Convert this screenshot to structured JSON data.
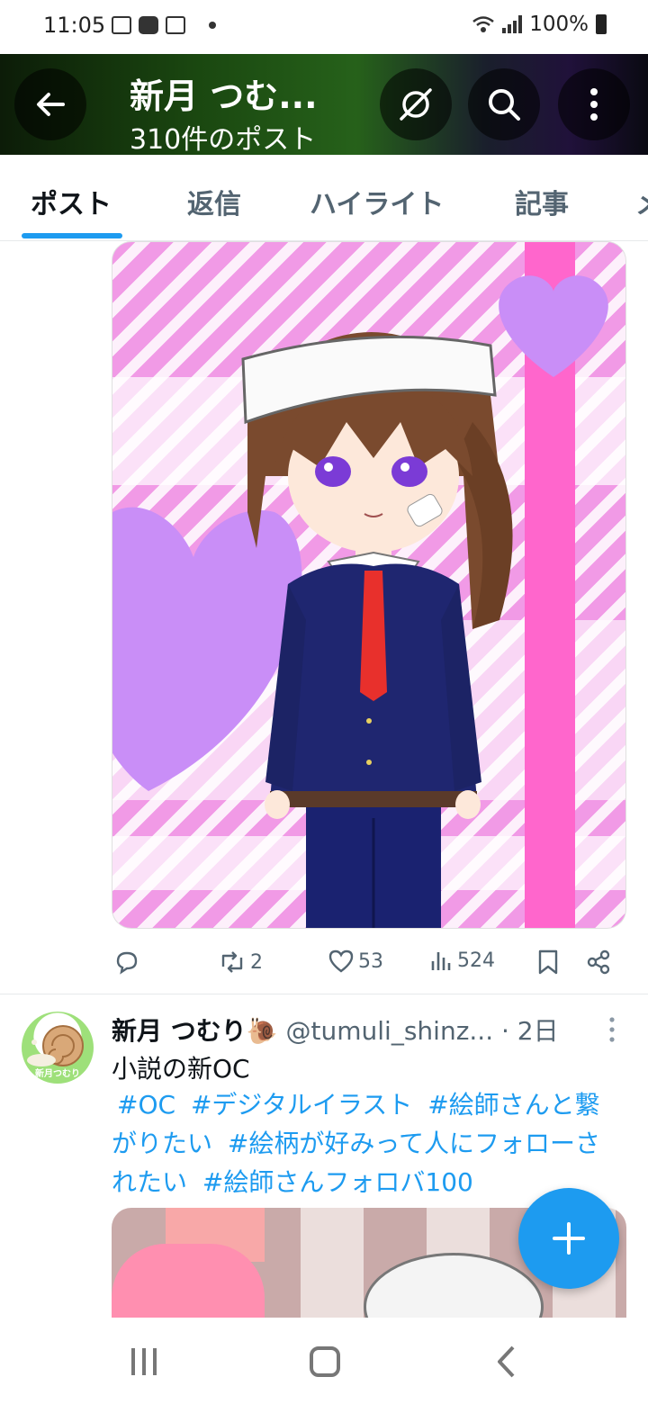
{
  "status_bar": {
    "time": "11:05",
    "battery": "100%"
  },
  "header": {
    "title": "新月 つむ...",
    "subtitle": "310件のポスト"
  },
  "tabs": [
    {
      "label": "ポスト",
      "active": true
    },
    {
      "label": "返信"
    },
    {
      "label": "ハイライト"
    },
    {
      "label": "記事"
    },
    {
      "label": "メ"
    }
  ],
  "post1": {
    "replies": "",
    "reposts": "2",
    "likes": "53",
    "views": "524"
  },
  "post2": {
    "name": "新月 つむり🐌",
    "handle": "@tumuli_shinz...",
    "time": "· 2日",
    "text": "小説の新OC",
    "tags": [
      "#OC",
      "#デジタルイラスト",
      "#絵師さんと繋がりたい",
      "#絵柄が好みって人にフォローされたい",
      "#絵師さんフォロバ100"
    ],
    "avatar_text": "新月つむり"
  },
  "colors": {
    "accent": "#1d9bf0",
    "muted": "#536471",
    "text": "#0f1419"
  },
  "icons": {
    "back": "arrow-left-icon",
    "offline": "no-signal-icon",
    "search": "search-icon",
    "more": "more-vertical-icon",
    "reply": "reply-icon",
    "repost": "repost-icon",
    "like": "heart-icon",
    "views": "views-icon",
    "bookmark": "bookmark-icon",
    "share": "share-icon",
    "compose": "plus-icon"
  }
}
